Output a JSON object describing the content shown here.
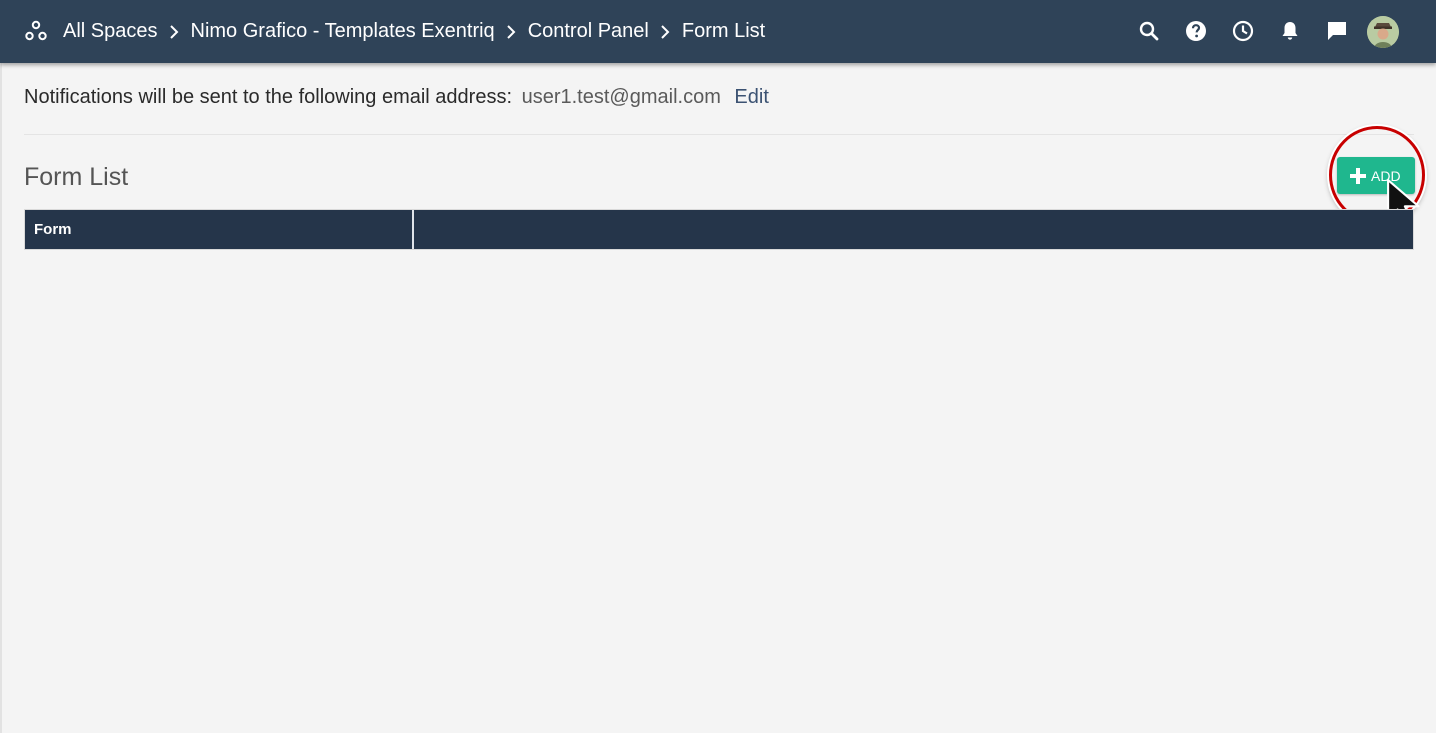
{
  "header": {
    "breadcrumb": {
      "all_spaces": "All Spaces",
      "space": "Nimo Grafico - Templates Exentriq",
      "control_panel": "Control Panel",
      "current": "Form List"
    },
    "icons": [
      "spaces-icon",
      "search-icon",
      "help-icon",
      "clock-icon",
      "bell-icon",
      "chat-icon",
      "avatar"
    ],
    "bg_color": "#2f4358"
  },
  "notifications": {
    "text": "Notifications will be sent to the following email address:",
    "email": "user1.test@gmail.com",
    "edit_label": "Edit"
  },
  "form_list": {
    "title": "Form List",
    "add_label": "ADD",
    "add_color": "#1fb78e",
    "columns": [
      "Form",
      ""
    ]
  }
}
